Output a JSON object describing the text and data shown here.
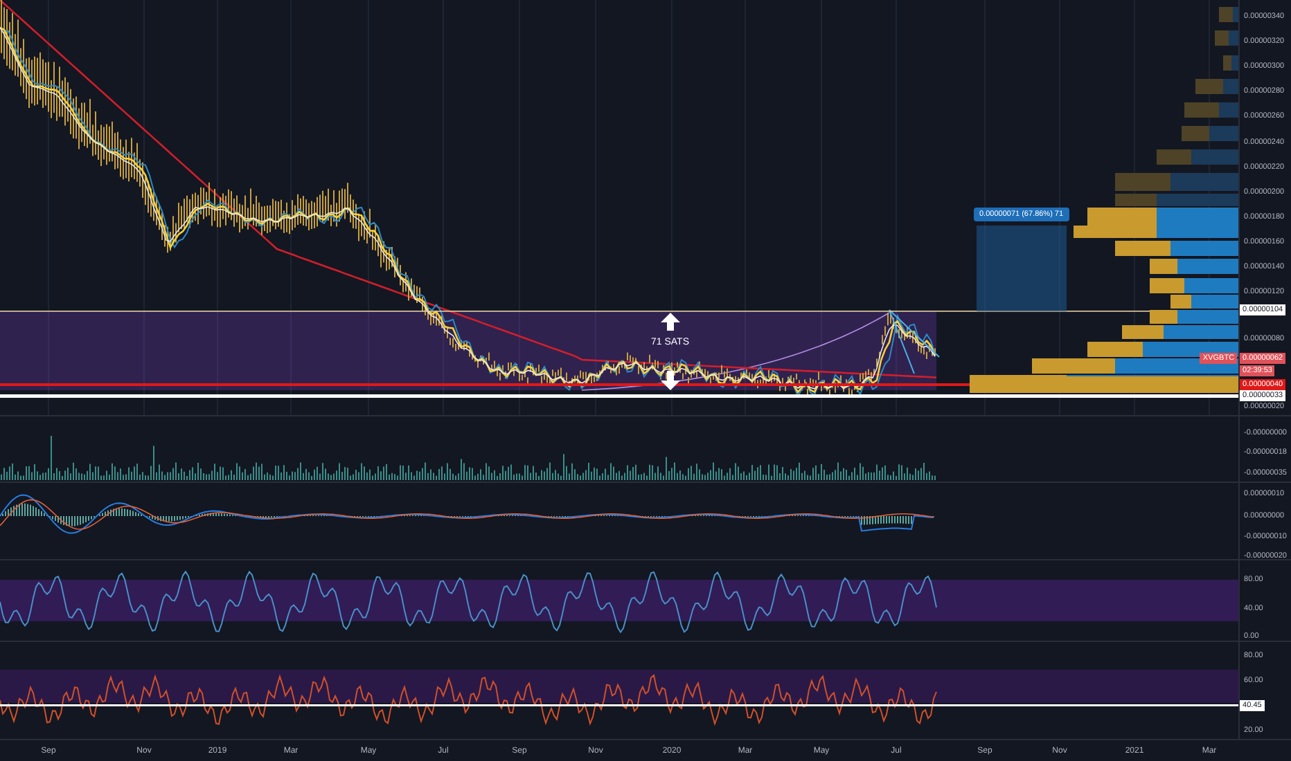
{
  "price_pane": {
    "axis_labels": [
      "0.00000340",
      "0.00000320",
      "0.00000300",
      "0.00000280",
      "0.00000260",
      "0.00000240",
      "0.00000220",
      "0.00000200",
      "0.00000180",
      "0.00000160",
      "0.00000140",
      "0.00000120",
      "0.00000080",
      "0.00000020"
    ],
    "tags": [
      {
        "kind": "line",
        "text": "0.00000104"
      },
      {
        "kind": "symbol",
        "text": "XVGBTC"
      },
      {
        "kind": "price",
        "text": "0.00000062"
      },
      {
        "kind": "countdown",
        "text": "02:39:53"
      },
      {
        "kind": "support",
        "text": "0.00000040"
      },
      {
        "kind": "line",
        "text": "0.00000033"
      }
    ],
    "measure_label": "0.00000071 (67.86%) 71",
    "range_label": "71 SATS"
  },
  "volume_pane": {
    "axis_labels": [
      "-0.00000000",
      "-0.00000018",
      "-0.00000035"
    ]
  },
  "macd_pane": {
    "axis_labels": [
      "0.00000010",
      "0.00000000",
      "-0.00000010",
      "-0.00000020"
    ]
  },
  "rsi_pane": {
    "axis_labels": [
      "80.00",
      "40.00",
      "0.00"
    ]
  },
  "stoch_pane": {
    "axis_labels": [
      "80.00",
      "60.00",
      "20.00"
    ],
    "tag": "40.45"
  },
  "time_axis": [
    "Sep",
    "Nov",
    "2019",
    "Mar",
    "May",
    "Jul",
    "Sep",
    "Nov",
    "2020",
    "Mar",
    "May",
    "Jul",
    "Sep",
    "Nov",
    "2021",
    "Mar"
  ]
}
